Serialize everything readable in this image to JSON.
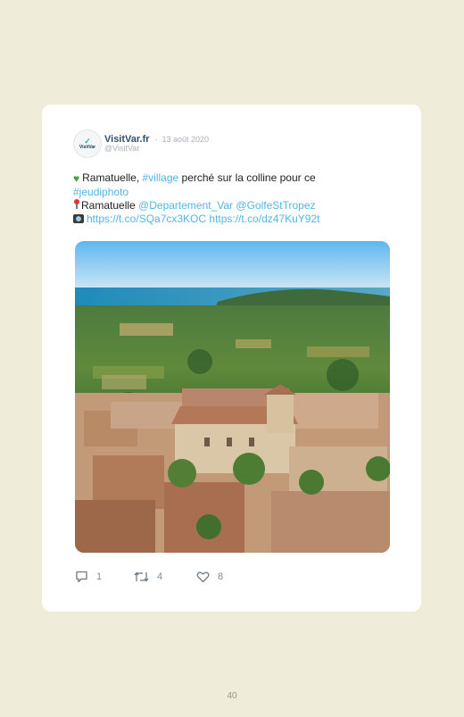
{
  "tweet": {
    "author": {
      "name": "VisitVar.fr",
      "handle": "@VisitVar",
      "avatar_text": "VisitVar"
    },
    "separator": "·",
    "date": "13 août 2020",
    "text": {
      "line1": {
        "emoji": "green-heart",
        "before": "Ramatuelle, ",
        "hashtag": "#village",
        "after": " perché sur la colline pour ce"
      },
      "line2": {
        "hashtag": "#jeudiphoto"
      },
      "line3": {
        "emoji": "round-pushpin",
        "place": "Ramatuelle",
        "mention1": "@Departement_Var",
        "mention2": "@GolfeStTropez"
      },
      "line4": {
        "emoji": "camera",
        "url1": "https://t.co/SQa7cx3KOC",
        "url2": "https://t.co/dz47KuY92t"
      }
    },
    "actions": {
      "replies": "1",
      "retweets": "4",
      "likes": "8"
    },
    "icons": {
      "reply": "reply-icon",
      "retweet": "retweet-icon",
      "like": "heart-icon"
    }
  },
  "footer": {
    "page_number": "40"
  },
  "colors": {
    "background": "#efecd9",
    "link": "#52b6e6",
    "name": "#2e4f6e",
    "muted": "#a7b1b9"
  }
}
